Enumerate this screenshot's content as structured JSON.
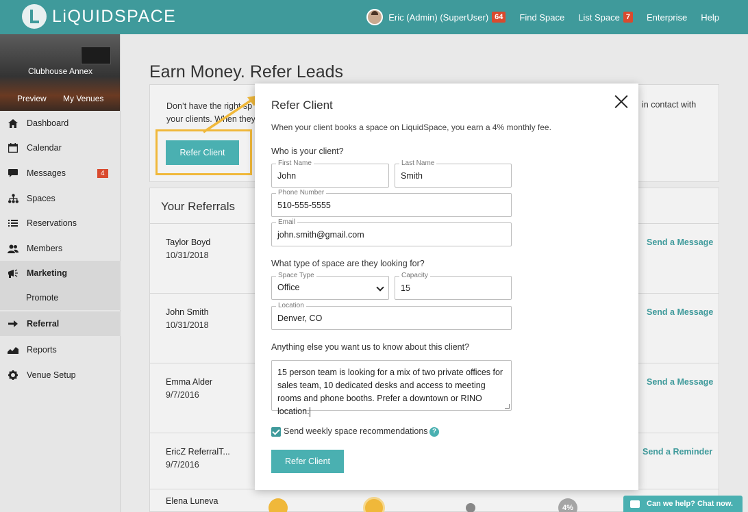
{
  "header": {
    "logo_text": "LiQUIDSPACE",
    "user_label": "Eric (Admin) (SuperUser)",
    "user_badge": "64",
    "find_space": "Find Space",
    "list_space": "List Space",
    "list_badge": "7",
    "enterprise": "Enterprise",
    "help": "Help"
  },
  "sidebar": {
    "venue_name": "Clubhouse Annex",
    "preview": "Preview",
    "my_venues": "My Venues",
    "items": [
      {
        "label": "Dashboard",
        "icon": "home-icon"
      },
      {
        "label": "Calendar",
        "icon": "calendar-icon"
      },
      {
        "label": "Messages",
        "icon": "chat-icon",
        "badge": "4"
      },
      {
        "label": "Spaces",
        "icon": "sitemap-icon"
      },
      {
        "label": "Reservations",
        "icon": "list-icon"
      },
      {
        "label": "Members",
        "icon": "people-icon"
      },
      {
        "label": "Marketing",
        "icon": "megaphone-icon"
      },
      {
        "label": "Promote",
        "icon": ""
      },
      {
        "label": "Referral",
        "icon": "arrow-right-icon"
      },
      {
        "label": "Reports",
        "icon": "chart-icon"
      },
      {
        "label": "Venue Setup",
        "icon": "gear-icon"
      }
    ]
  },
  "main": {
    "title": "Earn Money. Refer Leads",
    "intro_left": "Don’t have the right sp",
    "intro_left2": "your clients. When they",
    "intro_right": "in contact with",
    "refer_button": "Refer Client",
    "referrals_title": "Your Referrals",
    "referrals": [
      {
        "name": "Taylor Boyd",
        "date": "10/31/2018",
        "action": "Send a Message"
      },
      {
        "name": "John Smith",
        "date": "10/31/2018",
        "action": "Send a Message"
      },
      {
        "name": "Emma Alder",
        "date": "9/7/2016",
        "action": "Send a Message"
      },
      {
        "name": "EricZ ReferralT...",
        "date": "9/7/2016",
        "action": "Send a Reminder"
      },
      {
        "name": "Elena Luneva",
        "date": "",
        "action": ""
      }
    ],
    "progress_label": "4%"
  },
  "modal": {
    "title": "Refer Client",
    "subtitle": "When your client books a space on LiquidSpace, you earn a 4% monthly fee.",
    "q_who": "Who is your client?",
    "first_name_label": "First Name",
    "first_name": "John",
    "last_name_label": "Last Name",
    "last_name": "Smith",
    "phone_label": "Phone Number",
    "phone": "510-555-5555",
    "email_label": "Email",
    "email": "john.smith@gmail.com",
    "q_type": "What type of space are they looking for?",
    "space_type_label": "Space Type",
    "space_type": "Office",
    "capacity_label": "Capacity",
    "capacity": "15",
    "location_label": "Location",
    "location": "Denver, CO",
    "q_else": "Anything else you want us to know about this client?",
    "notes": "15 person team is looking for a mix of two private offices for sales team, 10 dedicated desks and access to meeting rooms and phone booths. Prefer a downtown or RINO location.",
    "checkbox_label": "Send weekly space recommendations",
    "checkbox_checked": true,
    "help_mark": "?",
    "submit": "Refer Client"
  },
  "chat": {
    "label": "Can we help? Chat now."
  },
  "colors": {
    "brand": "#3f9a9b",
    "accent": "#4ab0b1",
    "badge": "#d94a2e",
    "highlight": "#f0b83a"
  }
}
